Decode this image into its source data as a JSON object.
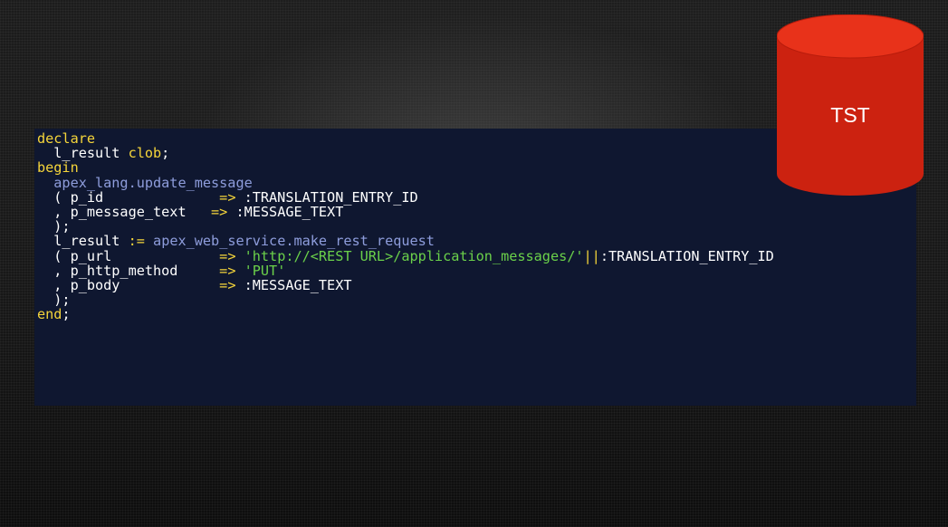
{
  "database": {
    "label": "TST",
    "fill_color": "#cc2210",
    "top_color": "#e8321a"
  },
  "code_panel": {
    "background": "#0f1730",
    "lines": [
      [
        {
          "t": "declare",
          "c": "kw"
        }
      ],
      [
        {
          "t": "  l_result ",
          "c": "plain"
        },
        {
          "t": "clob",
          "c": "kw"
        },
        {
          "t": ";",
          "c": "plain"
        }
      ],
      [
        {
          "t": "begin",
          "c": "kw"
        }
      ],
      [
        {
          "t": "  apex_lang.update_message",
          "c": "fn"
        }
      ],
      [
        {
          "t": "  ( p_id              ",
          "c": "plain"
        },
        {
          "t": "=>",
          "c": "op"
        },
        {
          "t": " :TRANSLATION_ENTRY_ID",
          "c": "plain"
        }
      ],
      [
        {
          "t": "  , p_message_text   ",
          "c": "plain"
        },
        {
          "t": "=>",
          "c": "op"
        },
        {
          "t": " :MESSAGE_TEXT",
          "c": "plain"
        }
      ],
      [
        {
          "t": "  );",
          "c": "plain"
        }
      ],
      [
        {
          "t": "  l_result ",
          "c": "plain"
        },
        {
          "t": ":=",
          "c": "op"
        },
        {
          "t": " ",
          "c": "plain"
        },
        {
          "t": "apex_web_service.make_rest_request",
          "c": "fn"
        }
      ],
      [
        {
          "t": "  ( p_url             ",
          "c": "plain"
        },
        {
          "t": "=>",
          "c": "op"
        },
        {
          "t": " ",
          "c": "plain"
        },
        {
          "t": "'http://<REST URL>/application_messages/'",
          "c": "str"
        },
        {
          "t": "||",
          "c": "op"
        },
        {
          "t": ":TRANSLATION_ENTRY_ID",
          "c": "plain"
        }
      ],
      [
        {
          "t": "  , p_http_method     ",
          "c": "plain"
        },
        {
          "t": "=>",
          "c": "op"
        },
        {
          "t": " ",
          "c": "plain"
        },
        {
          "t": "'PUT'",
          "c": "str"
        }
      ],
      [
        {
          "t": "  , p_body            ",
          "c": "plain"
        },
        {
          "t": "=>",
          "c": "op"
        },
        {
          "t": " :MESSAGE_TEXT",
          "c": "plain"
        }
      ],
      [
        {
          "t": "  );",
          "c": "plain"
        }
      ],
      [
        {
          "t": "end",
          "c": "kw"
        },
        {
          "t": ";",
          "c": "plain"
        }
      ]
    ]
  }
}
